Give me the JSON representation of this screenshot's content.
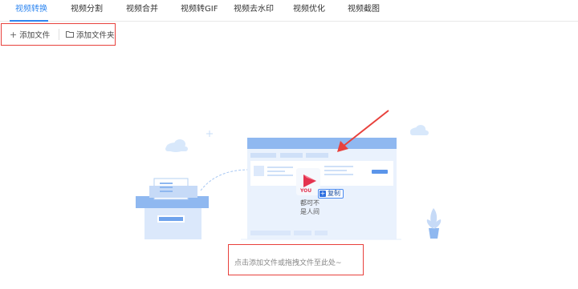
{
  "tabs": [
    {
      "label": "视频转换",
      "active": true
    },
    {
      "label": "视频分割",
      "active": false
    },
    {
      "label": "视频合并",
      "active": false
    },
    {
      "label": "视频转GIF",
      "active": false
    },
    {
      "label": "视频去水印",
      "active": false
    },
    {
      "label": "视频优化",
      "active": false
    },
    {
      "label": "视频截图",
      "active": false
    }
  ],
  "toolbar": {
    "add_file_label": "添加文件",
    "add_file_icon": "plus-icon",
    "add_folder_label": "添加文件夹",
    "add_folder_icon": "folder-icon"
  },
  "dropzone": {
    "hint": "点击添加文件或拖拽文件至此处~",
    "copy_label": "复制",
    "file_name": "都可不",
    "file_name_line2": "是人间",
    "app_text": "YOU"
  },
  "colors": {
    "accent": "#2e86f0",
    "highlight_border": "#e8413c",
    "illustration_blue": "#8fb8f0",
    "illustration_light": "#e6f0fc",
    "file_icon_pink": "#e4334f"
  }
}
